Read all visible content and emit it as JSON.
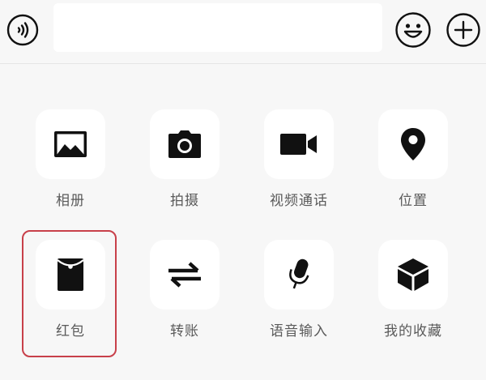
{
  "input_bar": {
    "voice_icon": "voice-wave-icon",
    "text_value": "",
    "emoji_icon": "emoji-smile-icon",
    "plus_icon": "plus-circle-icon"
  },
  "panel": {
    "items": [
      {
        "label": "相册",
        "icon": "photo-album-icon"
      },
      {
        "label": "拍摄",
        "icon": "camera-icon"
      },
      {
        "label": "视频通话",
        "icon": "video-camera-icon"
      },
      {
        "label": "位置",
        "icon": "location-pin-icon"
      },
      {
        "label": "红包",
        "icon": "red-packet-icon"
      },
      {
        "label": "转账",
        "icon": "transfer-arrows-icon"
      },
      {
        "label": "语音输入",
        "icon": "microphone-icon"
      },
      {
        "label": "我的收藏",
        "icon": "favorites-cube-icon"
      }
    ],
    "highlighted_item": "红包"
  },
  "colors": {
    "background": "#f7f7f7",
    "tile": "#ffffff",
    "icon": "#111111",
    "label": "#5a5a5a",
    "highlight_border": "#c8404a"
  }
}
